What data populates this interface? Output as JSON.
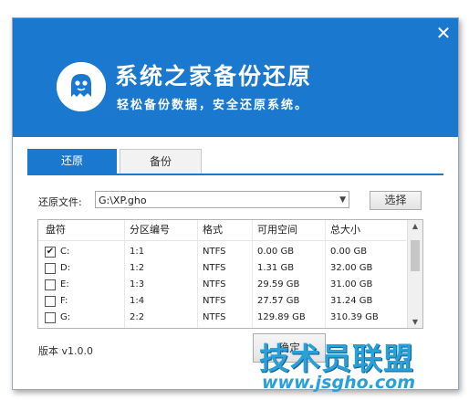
{
  "window": {
    "close_icon": "close-icon",
    "title": "系统之家备份还原",
    "subtitle": "轻松备份数据，安全还原系统。",
    "brand_color": "#1b78cf"
  },
  "tabs": [
    {
      "label": "还原",
      "active": true
    },
    {
      "label": "备份",
      "active": false
    }
  ],
  "file_row": {
    "label": "还原文件:",
    "value": "G:\\XP.gho",
    "browse_label": "选择"
  },
  "table": {
    "headers": [
      "盘符",
      "分区编号",
      "格式",
      "可用空间",
      "总大小"
    ],
    "rows": [
      {
        "checked": true,
        "drive": "C:",
        "part": "1:1",
        "fs": "NTFS",
        "free": "0.00 GB",
        "total": "0.00 GB"
      },
      {
        "checked": false,
        "drive": "D:",
        "part": "1:2",
        "fs": "NTFS",
        "free": "1.31 GB",
        "total": "32.00 GB"
      },
      {
        "checked": false,
        "drive": "E:",
        "part": "1:3",
        "fs": "NTFS",
        "free": "29.59 GB",
        "total": "31.00 GB"
      },
      {
        "checked": false,
        "drive": "F:",
        "part": "1:4",
        "fs": "NTFS",
        "free": "27.57 GB",
        "total": "31.24 GB"
      },
      {
        "checked": false,
        "drive": "G:",
        "part": "2:2",
        "fs": "NTFS",
        "free": "129.89 GB",
        "total": "310.39 GB"
      }
    ]
  },
  "footer": {
    "version": "版本 v1.0.0",
    "restore_label": "确定"
  },
  "watermark": {
    "text": "技术员联盟",
    "url": "www.jsgho.com"
  }
}
